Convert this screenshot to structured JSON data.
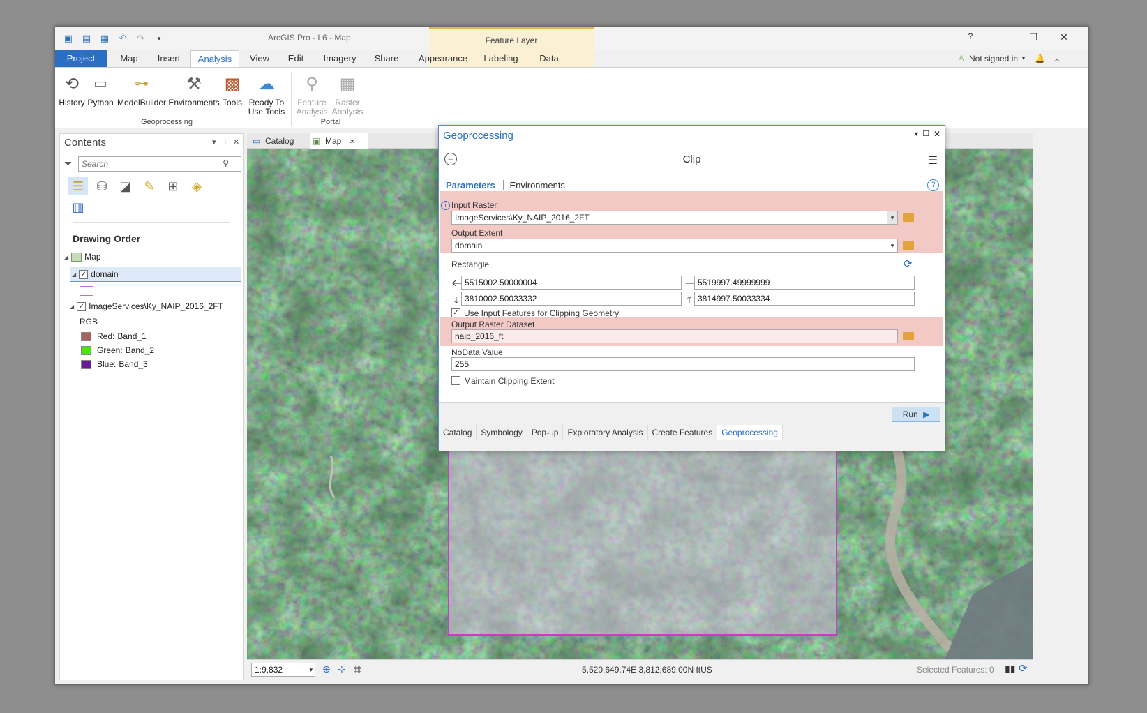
{
  "app": {
    "title": "ArcGIS Pro - L6 - Map",
    "contextual_tab_group": "Feature Layer",
    "help": "?",
    "sign_in": "Not signed in"
  },
  "ribbon_tabs": [
    "Project",
    "Map",
    "Insert",
    "Analysis",
    "View",
    "Edit",
    "Imagery",
    "Share",
    "Appearance",
    "Labeling",
    "Data"
  ],
  "ribbon": {
    "history": "History",
    "python": "Python",
    "modelbuilder": "ModelBuilder",
    "environments": "Environments",
    "tools": "Tools",
    "ready_to_use_1": "Ready To",
    "ready_to_use_2": "Use Tools",
    "group_geoprocessing": "Geoprocessing",
    "feature_analysis_1": "Feature",
    "feature_analysis_2": "Analysis",
    "raster_analysis_1": "Raster",
    "raster_analysis_2": "Analysis",
    "group_portal": "Portal"
  },
  "contents": {
    "title": "Contents",
    "search_placeholder": "Search",
    "drawing_order": "Drawing Order",
    "map_node": "Map",
    "layer_domain": "domain",
    "layer_raster": "ImageServices\\Ky_NAIP_2016_2FT",
    "rgb": "RGB",
    "bands": [
      {
        "label": "Red:",
        "band": "Band_1",
        "color": "#a86060"
      },
      {
        "label": "Green:",
        "band": "Band_2",
        "color": "#4ce600"
      },
      {
        "label": "Blue:",
        "band": "Band_3",
        "color": "#6a1a9a"
      }
    ]
  },
  "map_tabs": [
    "Catalog",
    "Map"
  ],
  "statusbar": {
    "scale": "1:9,832",
    "coordinates": "5,520,649.74E 3,812,689.00N ftUS",
    "selected_features": "Selected Features: 0"
  },
  "geoprocessing": {
    "title": "Geoprocessing",
    "tool": "Clip",
    "tab_parameters": "Parameters",
    "tab_environments": "Environments",
    "input_raster_label": "Input Raster",
    "input_raster_value": "ImageServices\\Ky_NAIP_2016_2FT",
    "output_extent_label": "Output Extent",
    "output_extent_value": "domain",
    "rectangle_label": "Rectangle",
    "left": "5515002.50000004",
    "right": "5519997.49999999",
    "bottom": "3810002.50033332",
    "top": "3814997.50033334",
    "use_input_features": "Use Input Features for Clipping Geometry",
    "output_dataset_label": "Output Raster Dataset",
    "output_dataset_value": "naip_2016_ft",
    "nodata_label": "NoData Value",
    "nodata_value": "255",
    "maintain_extent": "Maintain Clipping Extent",
    "run": "Run",
    "pane_tabs": [
      "Catalog",
      "Symbology",
      "Pop-up",
      "Exploratory Analysis",
      "Create Features",
      "Geoprocessing"
    ]
  },
  "colors": {
    "accent": "#2a6fc4",
    "error_band": "#f3c9c5",
    "domain_outline": "#c33fc7"
  }
}
